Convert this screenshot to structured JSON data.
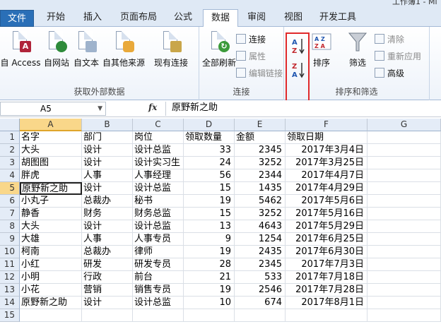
{
  "window": {
    "title": "工作簿1 - Mi"
  },
  "tabs": [
    "文件",
    "开始",
    "插入",
    "页面布局",
    "公式",
    "数据",
    "审阅",
    "视图",
    "开发工具"
  ],
  "ribbon": {
    "external": {
      "label": "获取外部数据",
      "access": "自 Access",
      "web": "自网站",
      "text": "自文本",
      "other": "自其他来源",
      "existing": "现有连接"
    },
    "connections": {
      "label": "连接",
      "refresh_all": "全部刷新",
      "connect": "连接",
      "properties": "属性",
      "edit_links": "编辑链接"
    },
    "sort_filter": {
      "label": "排序和筛选",
      "sort": "排序",
      "filter": "筛选",
      "clear": "清除",
      "reapply": "重新应用",
      "advanced": "高级"
    }
  },
  "formula_bar": {
    "name_box": "A5",
    "fx": "fx",
    "content": "原野新之助"
  },
  "sheet": {
    "columns": [
      "A",
      "B",
      "C",
      "D",
      "E",
      "F",
      "G"
    ],
    "rows": [
      [
        "名字",
        "部门",
        "岗位",
        "领取数量",
        "金额",
        "领取日期"
      ],
      [
        "大头",
        "设计",
        "设计总监",
        "33",
        "2345",
        "2017年3月4日"
      ],
      [
        "胡图图",
        "设计",
        "设计实习生",
        "24",
        "3252",
        "2017年3月25日"
      ],
      [
        "胖虎",
        "人事",
        "人事经理",
        "56",
        "2344",
        "2017年4月7日"
      ],
      [
        "原野新之助",
        "设计",
        "设计总监",
        "15",
        "1435",
        "2017年4月29日"
      ],
      [
        "小丸子",
        "总裁办",
        "秘书",
        "19",
        "5462",
        "2017年5月6日"
      ],
      [
        "静香",
        "财务",
        "财务总监",
        "15",
        "3252",
        "2017年5月16日"
      ],
      [
        "大头",
        "设计",
        "设计总监",
        "13",
        "4643",
        "2017年5月29日"
      ],
      [
        "大雄",
        "人事",
        "人事专员",
        "9",
        "1254",
        "2017年6月25日"
      ],
      [
        "柯南",
        "总裁办",
        "律师",
        "19",
        "2435",
        "2017年6月30日"
      ],
      [
        "小红",
        "研发",
        "研发专员",
        "28",
        "2345",
        "2017年7月3日"
      ],
      [
        "小明",
        "行政",
        "前台",
        "21",
        "533",
        "2017年7月18日"
      ],
      [
        "小花",
        "营销",
        "销售专员",
        "19",
        "2546",
        "2017年7月28日"
      ],
      [
        "原野新之助",
        "设计",
        "设计总监",
        "10",
        "674",
        "2017年8月1日"
      ],
      [
        "",
        "",
        "",
        "",
        "",
        ""
      ]
    ],
    "row_numbers": [
      "1",
      "2",
      "3",
      "4",
      "5",
      "6",
      "7",
      "8",
      "9",
      "10",
      "11",
      "12",
      "13",
      "14",
      "15"
    ]
  }
}
